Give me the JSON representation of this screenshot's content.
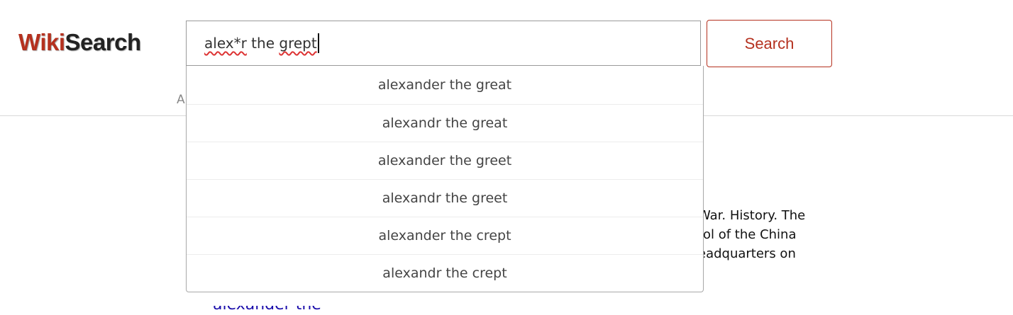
{
  "header": {
    "logo": {
      "part1": "Wiki",
      "part2": "Search"
    },
    "search": {
      "typed_underlined_1": "alex*r",
      "typed_plain": " the ",
      "typed_underlined_2": "grept"
    },
    "search_button_label": "Search"
  },
  "background": {
    "partial_letter": "A",
    "snippet_lines": [
      "War. History. The",
      "rol of the China",
      "eadquarters on"
    ],
    "link_peek": "alexander the"
  },
  "suggestions": [
    "alexander the great",
    "alexandr the great",
    "alexander the greet",
    "alexandr the greet",
    "alexander the crept",
    "alexandr the crept"
  ],
  "colors": {
    "brand": "#b5311f",
    "logo_dark": "#222222",
    "link": "#1a0dab"
  }
}
